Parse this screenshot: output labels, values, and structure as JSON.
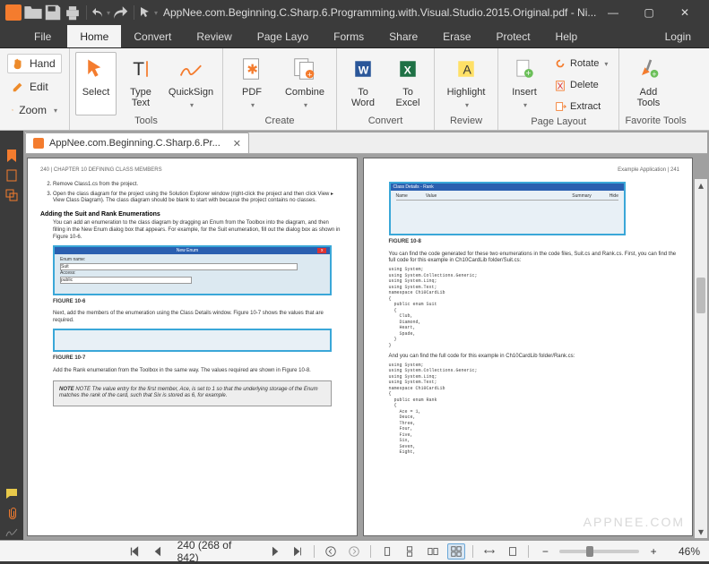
{
  "titlebar": {
    "title": "AppNee.com.Beginning.C.Sharp.6.Programming.with.Visual.Studio.2015.Original.pdf - Ni..."
  },
  "menu": {
    "file": "File",
    "home": "Home",
    "convert": "Convert",
    "review": "Review",
    "page": "Page Layo",
    "forms": "Forms",
    "share": "Share",
    "erase": "Erase",
    "protect": "Protect",
    "help": "Help",
    "login": "Login"
  },
  "sidetools": {
    "hand": "Hand",
    "edit": "Edit",
    "zoom": "Zoom"
  },
  "ribbon": {
    "tools": {
      "select": "Select",
      "type": "Type\nText",
      "quicksign": "QuickSign",
      "label": "Tools"
    },
    "create": {
      "pdf": "PDF",
      "combine": "Combine",
      "label": "Create"
    },
    "convert": {
      "word": "To\nWord",
      "excel": "To\nExcel",
      "label": "Convert"
    },
    "review": {
      "highlight": "Highlight",
      "label": "Review"
    },
    "pagelayout": {
      "insert": "Insert",
      "rotate": "Rotate",
      "delete": "Delete",
      "extract": "Extract",
      "label": "Page Layout"
    },
    "favs": {
      "addtools": "Add\nTools",
      "label": "Favorite Tools"
    }
  },
  "doctab": {
    "name": "AppNee.com.Beginning.C.Sharp.6.Pr..."
  },
  "pageLeft": {
    "header_left": "240  |  CHAPTER 10   DEFINING CLASS MEMBERS",
    "li2": "Remove Class1.cs from the project.",
    "li3": "Open the class diagram for the project using the Solution Explorer window (right-click the project and then click View ▸ View Class Diagram). The class diagram should be blank to start with because the project contains no classes.",
    "h1": "Adding the Suit and Rank Enumerations",
    "p1": "You can add an enumeration to the class diagram by dragging an Enum from the Toolbox into the diagram, and then filling in the New Enum dialog box that appears. For example, for the Suit enumeration, fill out the dialog box as shown in Figure 10-6.",
    "fig1": "FIGURE 10-6",
    "p2": "Next, add the members of the enumeration using the Class Details window. Figure 10-7 shows the values that are required.",
    "fig2": "FIGURE 10-7",
    "p3": "Add the Rank enumeration from the Toolbox in the same way. The values required are shown in Figure 10-8.",
    "note": "NOTE  The value entry for the first member, Ace, is set to 1 so that the underlying storage of the Enum matches the rank of the card, such that Six is stored as 6, for example."
  },
  "pageRight": {
    "header_right": "Example Application  |  241",
    "fig3": "FIGURE 10-8",
    "p1": "You can find the code generated for these two enumerations in the code files, Suit.cs and Rank.cs. First, you can find the full code for this example in Ch10CardLib folder/Suit.cs:",
    "code1": "using System;\nusing System.Collections.Generic;\nusing System.Linq;\nusing System.Text;\nnamespace Ch10CardLib\n{\n  public enum Suit\n  {\n    Club,\n    Diamond,\n    Heart,\n    Spade,\n  }\n}",
    "p2": "And you can find the full code for this example in Ch10CardLib folder/Rank.cs:",
    "code2": "using System;\nusing System.Collections.Generic;\nusing System.Linq;\nusing System.Text;\nnamespace Ch10CardLib\n{\n  public enum Rank\n  {\n    Ace = 1,\n    Deuce,\n    Three,\n    Four,\n    Five,\n    Six,\n    Seven,\n    Eight,"
  },
  "watermark": "APPNEE.COM",
  "status": {
    "page": "240 (268 of 842)",
    "zoom": "46%"
  }
}
